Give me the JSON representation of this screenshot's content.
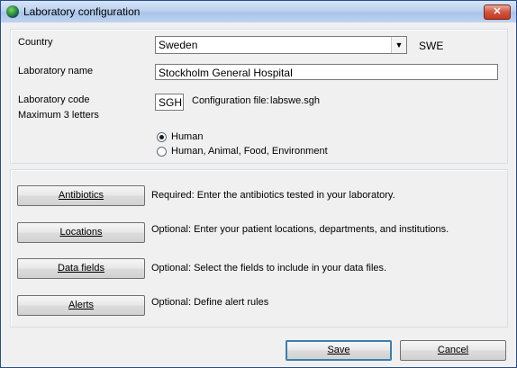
{
  "window": {
    "title": "Laboratory configuration",
    "close_glyph": "✕"
  },
  "country": {
    "label": "Country",
    "value": "Sweden",
    "code": "SWE",
    "arrow": "▼"
  },
  "lab_name": {
    "label": "Laboratory name",
    "value": "Stockholm General Hospital"
  },
  "lab_code": {
    "label": "Laboratory code",
    "hint": "Maximum 3 letters",
    "value": "SGH",
    "config_label": "Configuration file:",
    "config_file": "labswe.sgh"
  },
  "lab_type": {
    "options": [
      {
        "label": "Human",
        "checked": true
      },
      {
        "label": "Human, Animal, Food, Environment",
        "checked": false
      }
    ]
  },
  "actions": [
    {
      "label": "Antibiotics",
      "desc": "Required:  Enter the antibiotics tested in your laboratory."
    },
    {
      "label": "Locations",
      "desc": "Optional:  Enter your patient locations, departments, and institutions."
    },
    {
      "label": "Data fields",
      "desc": "Optional:  Select the fields to include in your data files."
    },
    {
      "label": "Alerts",
      "desc": "Optional:  Define alert rules"
    }
  ],
  "footer": {
    "save_label": "Save",
    "cancel_label": "Cancel"
  }
}
